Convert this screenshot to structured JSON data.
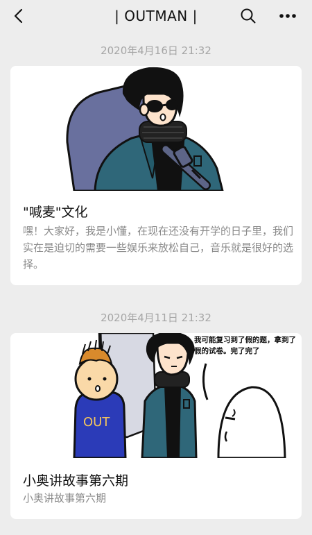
{
  "header": {
    "title": "| OUTMAN |",
    "back_icon": "chevron-left-icon",
    "search_icon": "search-icon",
    "more_icon": "more-dots-icon"
  },
  "articles": [
    {
      "date": "2020年4月16日 21:32",
      "title": "\"喊麦\"文化",
      "summary": "嘿！大家好，我是小懂，在现在还没有开学的日子里，我们实在是迫切的需要一些娱乐来放松自己，音乐就是很好的选择。",
      "image": "comic-character-with-microphone"
    },
    {
      "date": "2020年4月11日 21:32",
      "title": "小奥讲故事第六期",
      "summary": "小奥讲故事第六期",
      "image": "comic-three-characters",
      "comic_text": "我可能复习到了假的题，拿到了假的试卷。完了完了",
      "shirt_text": "OUT"
    }
  ]
}
